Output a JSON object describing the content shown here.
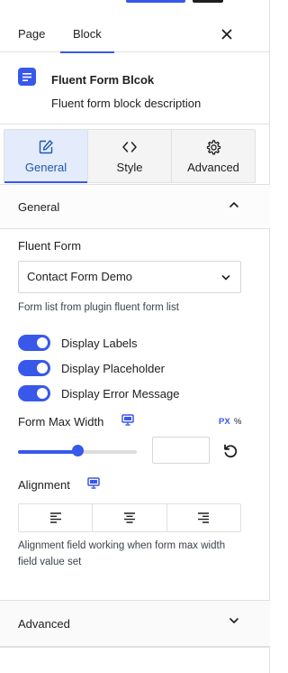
{
  "tabs": {
    "page": "Page",
    "block": "Block",
    "close_icon": "close-icon"
  },
  "block": {
    "title": "Fluent Form Blcok",
    "description": "Fluent form block description",
    "icon": "form-list-icon"
  },
  "style_tabs": [
    {
      "label": "General",
      "icon": "edit-icon",
      "active": true
    },
    {
      "label": "Style",
      "icon": "code-brackets-icon",
      "active": false
    },
    {
      "label": "Advanced",
      "icon": "gear-icon",
      "active": false
    }
  ],
  "general_section": {
    "title": "General",
    "expanded": true,
    "fluent_form": {
      "label": "Fluent Form",
      "selected": "Contact Form Demo",
      "help": "Form list from plugin fluent form list"
    },
    "toggles": [
      {
        "label": "Display Labels",
        "on": true
      },
      {
        "label": "Display Placeholder",
        "on": true
      },
      {
        "label": "Display Error Message",
        "on": true
      }
    ],
    "max_width": {
      "label": "Form Max Width",
      "units": [
        "PX",
        "%"
      ],
      "active_unit": "PX",
      "value": "",
      "slider_fraction": 0.5
    },
    "alignment": {
      "label": "Alignment",
      "options": [
        "left",
        "center",
        "right"
      ],
      "help_line1": "Alignment field working when form max width",
      "help_line2": "field value set"
    }
  },
  "advanced_section": {
    "title": "Advanced",
    "expanded": false
  },
  "colors": {
    "accent": "#3858e9",
    "active_tab_bg": "#e4ebfb"
  }
}
